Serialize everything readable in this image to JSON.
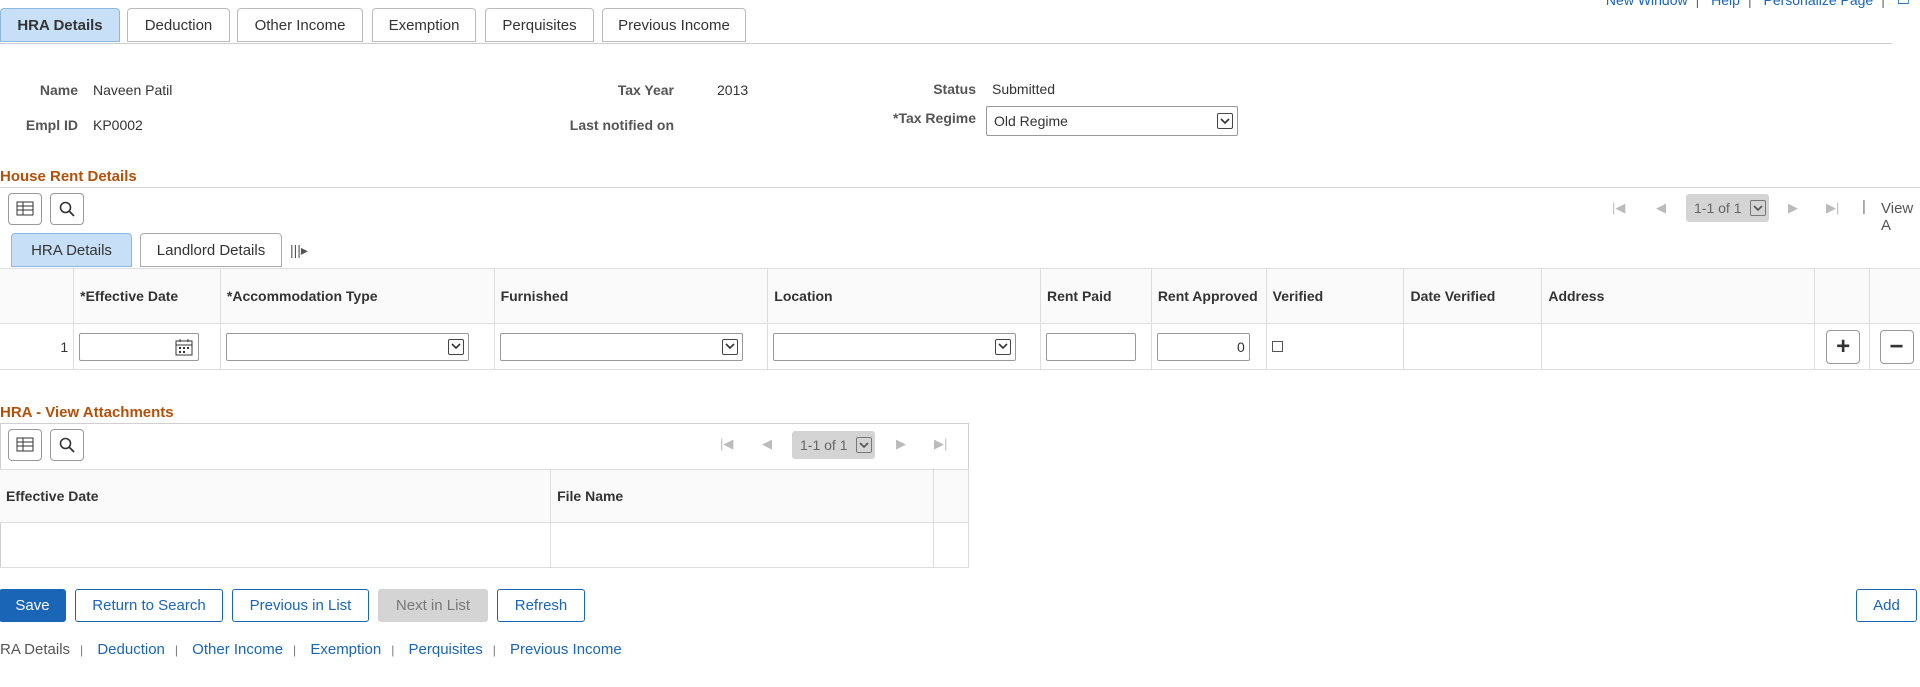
{
  "top_links": [
    "New Window",
    "Help",
    "Personalize Page"
  ],
  "tabs": [
    {
      "label": "HRA Details",
      "active": true
    },
    {
      "label": "Deduction"
    },
    {
      "label": "Other Income"
    },
    {
      "label": "Exemption"
    },
    {
      "label": "Perquisites"
    },
    {
      "label": "Previous Income"
    }
  ],
  "header": {
    "name_label": "Name",
    "name_value": "Naveen Patil",
    "emplid_label": "Empl ID",
    "emplid_value": "KP0002",
    "taxyear_label": "Tax Year",
    "taxyear_value": "2013",
    "lastnotified_label": "Last notified on",
    "lastnotified_value": "",
    "status_label": "Status",
    "status_value": "Submitted",
    "taxregime_label": "*Tax Regime",
    "taxregime_value": "Old Regime"
  },
  "house_rent": {
    "title": "House Rent Details",
    "pager": "1-1 of 1",
    "view_all": "View A",
    "subtabs": [
      {
        "label": "HRA Details",
        "active": true
      },
      {
        "label": "Landlord Details"
      }
    ],
    "columns": [
      "*Effective Date",
      "*Accommodation Type",
      "Furnished",
      "Location",
      "Rent Paid",
      "Rent Approved",
      "Verified",
      "Date Verified",
      "Address"
    ],
    "rows": [
      {
        "num": "1",
        "effective_date": "",
        "accommodation_type": "",
        "furnished": "",
        "location": "",
        "rent_paid": "",
        "rent_approved": "0",
        "verified": false,
        "date_verified": "",
        "address": ""
      }
    ]
  },
  "attachments": {
    "title": "HRA - View Attachments",
    "pager": "1-1 of 1",
    "columns": [
      "Effective Date",
      "File Name"
    ]
  },
  "buttons": {
    "save": "Save",
    "return_to_search": "Return to Search",
    "previous_in_list": "Previous in List",
    "next_in_list": "Next in List",
    "refresh": "Refresh",
    "add": "Add"
  },
  "footer_links": [
    "RA Details",
    "Deduction",
    "Other Income",
    "Exemption",
    "Perquisites",
    "Previous Income"
  ],
  "colors": {
    "accent": "#1a65b5",
    "section_title": "#b3500a",
    "active_tab": "#c8e0f7"
  }
}
